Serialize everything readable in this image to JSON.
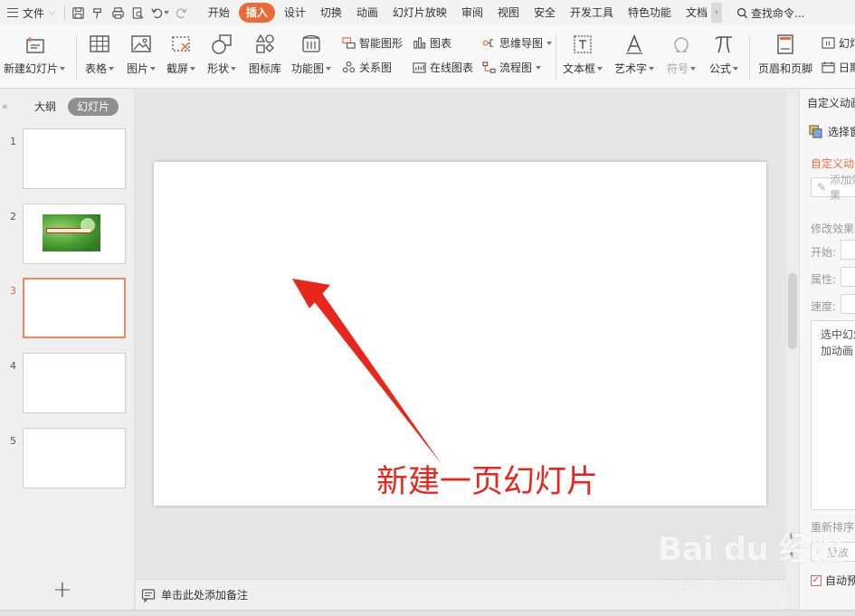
{
  "menubar": {
    "file_label": "文件",
    "tabs": [
      {
        "label": "开始"
      },
      {
        "label": "插入",
        "active": true
      },
      {
        "label": "设计"
      },
      {
        "label": "切换"
      },
      {
        "label": "动画"
      },
      {
        "label": "幻灯片放映"
      },
      {
        "label": "审阅"
      },
      {
        "label": "视图"
      },
      {
        "label": "安全"
      },
      {
        "label": "开发工具"
      },
      {
        "label": "特色功能"
      },
      {
        "label": "文档"
      }
    ],
    "search_label": "查找命令...",
    "accent_color": "#ec6a37"
  },
  "ribbon": {
    "new_slide": "新建幻灯片",
    "table": "表格",
    "picture": "图片",
    "screenshot": "截屏",
    "shape": "形状",
    "icon_library": "图标库",
    "function_chart": "功能图",
    "smart_art": "智能图形",
    "chart": "图表",
    "relation": "关系图",
    "online_chart": "在线图表",
    "mind_map": "思维导图",
    "flowchart": "流程图",
    "textbox": "文本框",
    "wordart": "艺术字",
    "symbol": "符号",
    "formula": "公式",
    "header_footer": "页眉和页脚",
    "slide_number": "幻灯",
    "date": "日期"
  },
  "left_panel": {
    "tab_outline": "大纲",
    "tab_slides": "幻灯片",
    "slides": [
      {
        "number": "1"
      },
      {
        "number": "2",
        "caption_text": ""
      },
      {
        "number": "3",
        "active": true
      },
      {
        "number": "4"
      },
      {
        "number": "5"
      }
    ]
  },
  "slide": {
    "annotation_text": "新建一页幻灯片",
    "annotation_color": "#e8261c"
  },
  "notes": {
    "placeholder": "单击此处添加备注"
  },
  "right_panel": {
    "title": "自定义动画",
    "select_pane": "选择窗格",
    "custom_heading": "自定义动画",
    "add_effect": "添加效果",
    "modify_heading": "修改效果",
    "start_label": "开始:",
    "property_label": "属性:",
    "speed_label": "速度:",
    "hint_line1": "选中幻灯",
    "hint_line2": "加动画",
    "reorder": "重新排序",
    "play_button": "播放",
    "autopreview": "自动预览"
  },
  "watermark": {
    "logo": "Bai du 经验",
    "url": "jingyan.baidu.com"
  }
}
